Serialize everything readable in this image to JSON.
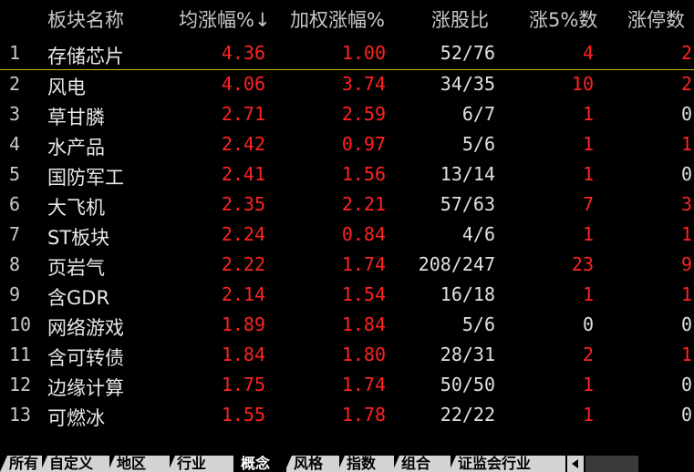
{
  "header": {
    "name": "板块名称",
    "avg": "均涨幅%",
    "sort_arrow": "↓",
    "weighted": "加权涨幅%",
    "ratio": "涨股比",
    "up5": "涨5%数",
    "limit": "涨停数"
  },
  "rows": [
    {
      "idx": "1",
      "name": "存储芯片",
      "avg": "4.36",
      "wt": "1.00",
      "ratio": "52/76",
      "up5": "4",
      "lim": "2"
    },
    {
      "idx": "2",
      "name": "风电",
      "avg": "4.06",
      "wt": "3.74",
      "ratio": "34/35",
      "up5": "10",
      "lim": "2"
    },
    {
      "idx": "3",
      "name": "草甘膦",
      "avg": "2.71",
      "wt": "2.59",
      "ratio": "6/7",
      "up5": "1",
      "lim": "0"
    },
    {
      "idx": "4",
      "name": "水产品",
      "avg": "2.42",
      "wt": "0.97",
      "ratio": "5/6",
      "up5": "1",
      "lim": "1"
    },
    {
      "idx": "5",
      "name": "国防军工",
      "avg": "2.41",
      "wt": "1.56",
      "ratio": "13/14",
      "up5": "1",
      "lim": "0"
    },
    {
      "idx": "6",
      "name": "大飞机",
      "avg": "2.35",
      "wt": "2.21",
      "ratio": "57/63",
      "up5": "7",
      "lim": "3"
    },
    {
      "idx": "7",
      "name": "ST板块",
      "avg": "2.24",
      "wt": "0.84",
      "ratio": "4/6",
      "up5": "1",
      "lim": "1"
    },
    {
      "idx": "8",
      "name": "页岩气",
      "avg": "2.22",
      "wt": "1.74",
      "ratio": "208/247",
      "up5": "23",
      "lim": "9"
    },
    {
      "idx": "9",
      "name": "含GDR",
      "avg": "2.14",
      "wt": "1.54",
      "ratio": "16/18",
      "up5": "1",
      "lim": "1"
    },
    {
      "idx": "10",
      "name": "网络游戏",
      "avg": "1.89",
      "wt": "1.84",
      "ratio": "5/6",
      "up5": "0",
      "lim": "0"
    },
    {
      "idx": "11",
      "name": "含可转债",
      "avg": "1.84",
      "wt": "1.80",
      "ratio": "28/31",
      "up5": "2",
      "lim": "1"
    },
    {
      "idx": "12",
      "name": "边缘计算",
      "avg": "1.75",
      "wt": "1.74",
      "ratio": "50/50",
      "up5": "1",
      "lim": "0"
    },
    {
      "idx": "13",
      "name": "可燃冰",
      "avg": "1.55",
      "wt": "1.78",
      "ratio": "22/22",
      "up5": "1",
      "lim": "0"
    }
  ],
  "tabs": [
    "所有",
    "自定义",
    "地区",
    "行业",
    "概念",
    "风格",
    "指数",
    "组合",
    "证监会行业"
  ],
  "active_tab": "概念",
  "colors": {
    "up": "#ff2222",
    "flat": "#e0e0e0",
    "selection_line": "#c8b400"
  }
}
